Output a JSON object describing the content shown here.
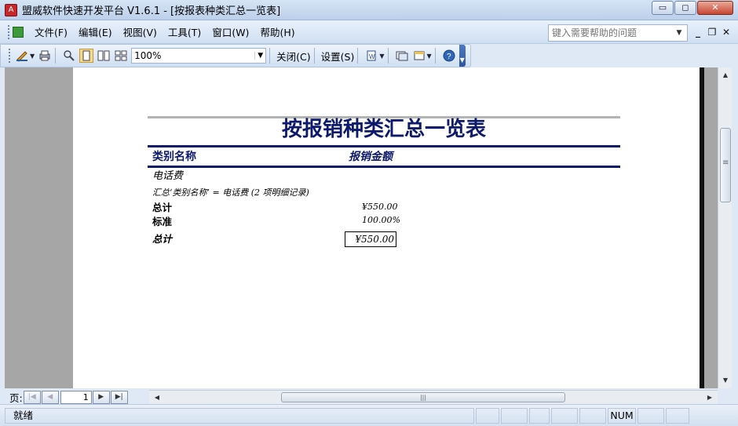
{
  "window": {
    "title": "盟威软件快速开发平台 V1.6.1 - [按报表种类汇总一览表]",
    "app_icon": "access-icon",
    "buttons": {
      "minimize": "▭",
      "maximize": "◻",
      "close": "✕"
    }
  },
  "menu": {
    "items": [
      "文件(F)",
      "编辑(E)",
      "视图(V)",
      "工具(T)",
      "窗口(W)",
      "帮助(H)"
    ],
    "help_placeholder": "键入需要帮助的问题",
    "mdi": {
      "minimize": "_",
      "restore": "❐",
      "close": "✕"
    }
  },
  "toolbar": {
    "zoom": "100%",
    "close_label": "关闭(C)",
    "setup_label": "设置(S)"
  },
  "report": {
    "title": "按报销种类汇总一览表",
    "col_category": "类别名称",
    "col_amount": "报销金额",
    "group_value": "电话费",
    "summary_line": "汇总‘类别名称’ = 电话费 (2 项明细记录)",
    "subtotal_label": "总计",
    "subtotal_value": "¥550.00",
    "std_label": "标准",
    "std_value": "100.00%",
    "grand_label": "总计",
    "grand_value": "¥550.00"
  },
  "pager": {
    "label": "页:",
    "page": "1"
  },
  "status": {
    "text": "就绪",
    "num": "NUM"
  }
}
